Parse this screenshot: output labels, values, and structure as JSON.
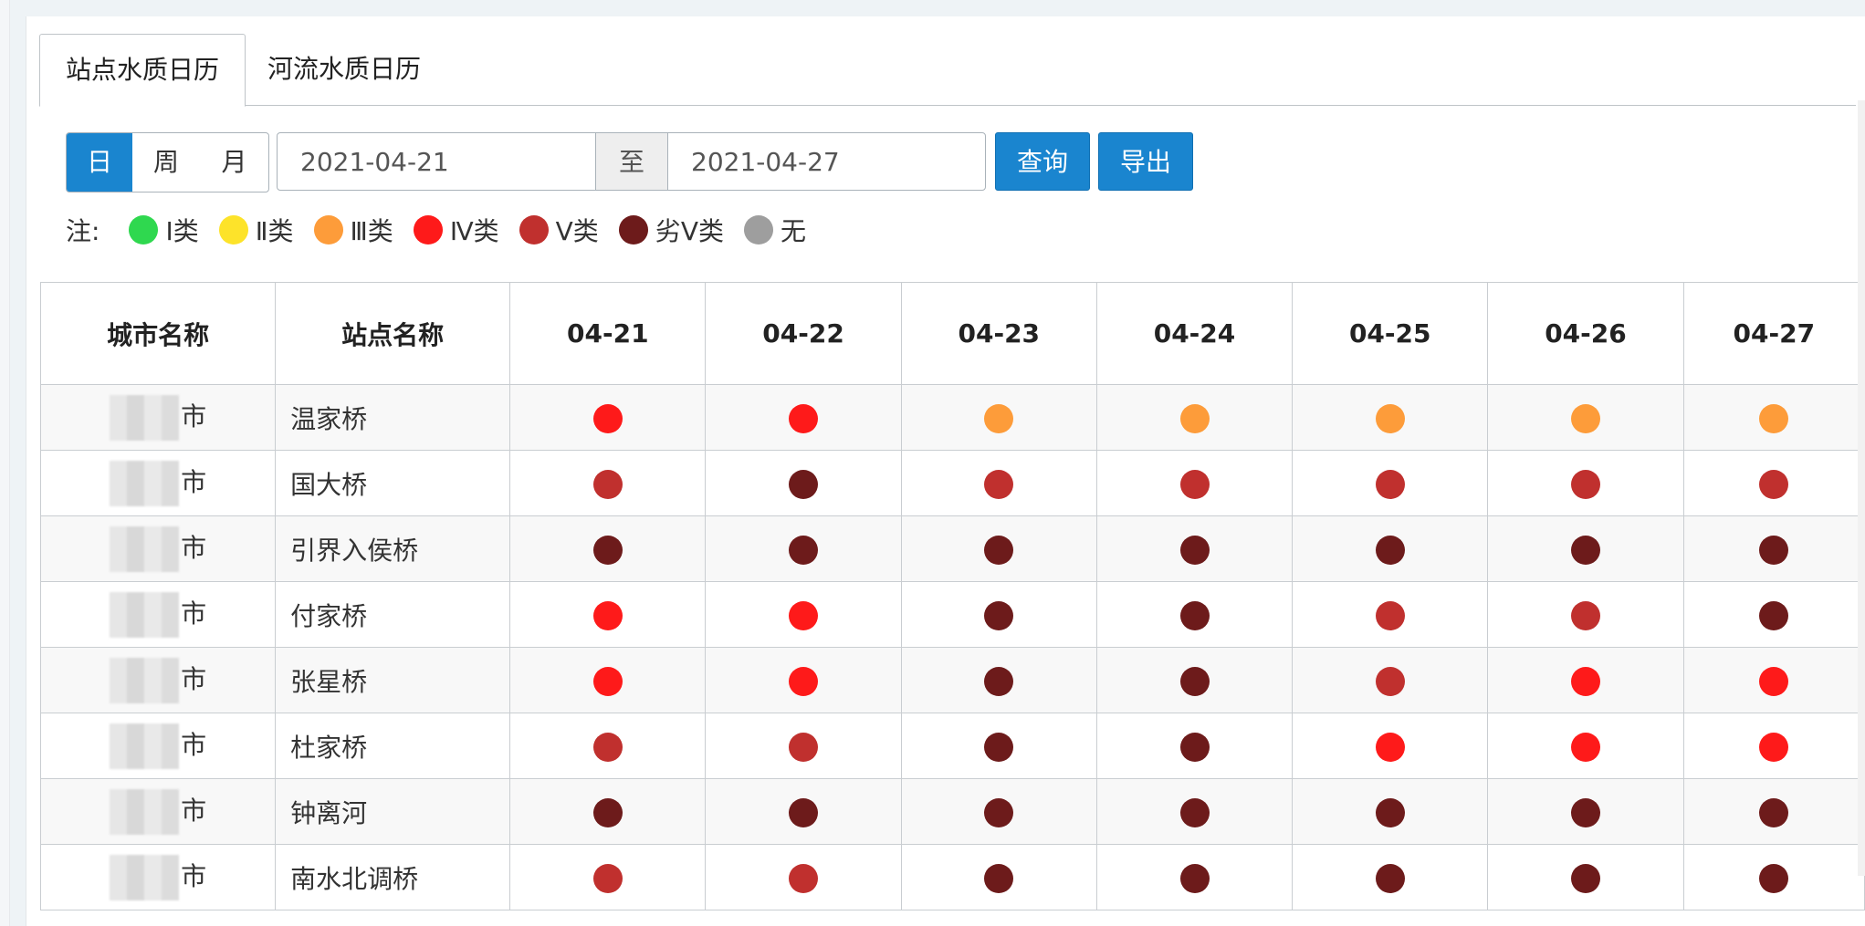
{
  "tabs": [
    {
      "label": "站点水质日历",
      "active": true
    },
    {
      "label": "河流水质日历",
      "active": false
    }
  ],
  "toolbar": {
    "period_options": [
      "日",
      "周",
      "月"
    ],
    "start_date": "2021-04-21",
    "to_label": "至",
    "end_date": "2021-04-27",
    "query_label": "查询",
    "export_label": "导出"
  },
  "legend": {
    "note_label": "注:",
    "items": [
      {
        "label": "Ⅰ类",
        "color": "#2fd84f"
      },
      {
        "label": "Ⅱ类",
        "color": "#fde32a"
      },
      {
        "label": "Ⅲ类",
        "color": "#fd9c3a"
      },
      {
        "label": "Ⅳ类",
        "color": "#fe1a1a"
      },
      {
        "label": "Ⅴ类",
        "color": "#c0302e"
      },
      {
        "label": "劣Ⅴ类",
        "color": "#6d1b1b"
      },
      {
        "label": "无",
        "color": "#9e9e9e"
      }
    ]
  },
  "table": {
    "headers": [
      "城市名称",
      "站点名称",
      "04-21",
      "04-22",
      "04-23",
      "04-24",
      "04-25",
      "04-26",
      "04-27"
    ],
    "rows": [
      {
        "city": "市",
        "station": "温家桥",
        "levels": [
          "Ⅳ类",
          "Ⅳ类",
          "Ⅲ类",
          "Ⅲ类",
          "Ⅲ类",
          "Ⅲ类",
          "Ⅲ类"
        ]
      },
      {
        "city": "市",
        "station": "国大桥",
        "levels": [
          "Ⅴ类",
          "劣Ⅴ类",
          "Ⅴ类",
          "Ⅴ类",
          "Ⅴ类",
          "Ⅴ类",
          "Ⅴ类"
        ]
      },
      {
        "city": "市",
        "station": "引界入侯桥",
        "levels": [
          "劣Ⅴ类",
          "劣Ⅴ类",
          "劣Ⅴ类",
          "劣Ⅴ类",
          "劣Ⅴ类",
          "劣Ⅴ类",
          "劣Ⅴ类"
        ]
      },
      {
        "city": "市",
        "station": "付家桥",
        "levels": [
          "Ⅳ类",
          "Ⅳ类",
          "劣Ⅴ类",
          "劣Ⅴ类",
          "Ⅴ类",
          "Ⅴ类",
          "劣Ⅴ类"
        ]
      },
      {
        "city": "市",
        "station": "张星桥",
        "levels": [
          "Ⅳ类",
          "Ⅳ类",
          "劣Ⅴ类",
          "劣Ⅴ类",
          "Ⅴ类",
          "Ⅳ类",
          "Ⅳ类"
        ]
      },
      {
        "city": "市",
        "station": "杜家桥",
        "levels": [
          "Ⅴ类",
          "Ⅴ类",
          "劣Ⅴ类",
          "劣Ⅴ类",
          "Ⅳ类",
          "Ⅳ类",
          "Ⅳ类"
        ]
      },
      {
        "city": "市",
        "station": "钟离河",
        "levels": [
          "劣Ⅴ类",
          "劣Ⅴ类",
          "劣Ⅴ类",
          "劣Ⅴ类",
          "劣Ⅴ类",
          "劣Ⅴ类",
          "劣Ⅴ类"
        ]
      },
      {
        "city": "市",
        "station": "南水北调桥",
        "levels": [
          "Ⅴ类",
          "Ⅴ类",
          "劣Ⅴ类",
          "劣Ⅴ类",
          "劣Ⅴ类",
          "劣Ⅴ类",
          "劣Ⅴ类"
        ]
      }
    ]
  }
}
